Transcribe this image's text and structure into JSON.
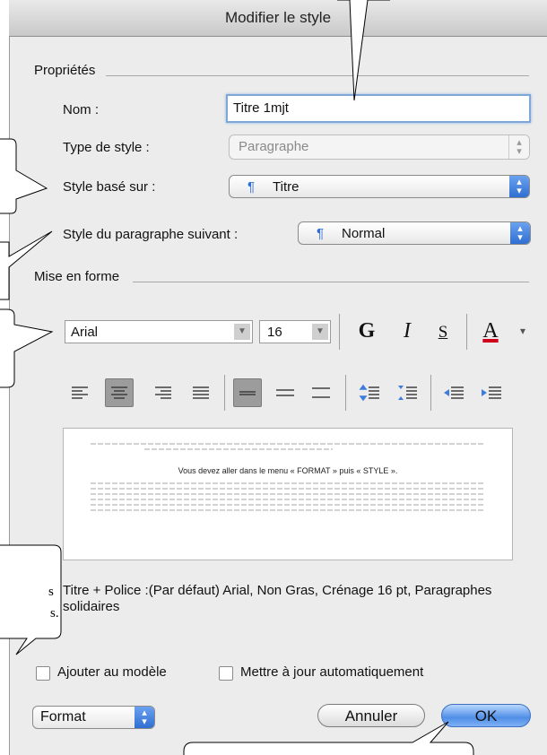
{
  "dialog": {
    "title": "Modifier le style"
  },
  "properties": {
    "section_label": "Propriétés",
    "name_label": "Nom :",
    "name_value": "Titre 1mjt",
    "style_type_label": "Type de style :",
    "style_type_value": "Paragraphe",
    "based_on_label": "Style basé sur :",
    "based_on_value": "Titre",
    "next_label": "Style du paragraphe suivant :",
    "next_value": "Normal",
    "paragraph_glyph": "¶"
  },
  "formatting": {
    "section_label": "Mise en forme",
    "font_value": "Arial",
    "size_value": "16",
    "bold_label": "G",
    "italic_label": "I",
    "underline_label": "S",
    "font_color_label": "A",
    "font_color": "#d0021b"
  },
  "preview": {
    "sample_text": "Vous devez aller dans le menu « FORMAT » puis « STYLE »."
  },
  "description": {
    "text": "Titre + Police :(Par défaut) Arial, Non Gras, Crénage 16 pt, Paragraphes solidaires"
  },
  "options": {
    "add_to_template_label": "Ajouter au modèle",
    "auto_update_label": "Mettre à jour automatiquement"
  },
  "footer": {
    "format_label": "Format",
    "cancel_label": "Annuler",
    "ok_label": "OK"
  },
  "callouts": {
    "partial_text_line1": "s",
    "partial_text_line2": "s."
  },
  "colors": {
    "accent": "#3d7ddb",
    "focus_ring": "#7ea7d8"
  }
}
